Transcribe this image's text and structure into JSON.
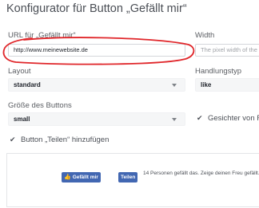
{
  "page": {
    "title": "Konfigurator für Button „Gefällt mir“"
  },
  "url_field": {
    "label": "URL für „Gefällt mir“",
    "value": "http://www.meinewebsite.de"
  },
  "width_field": {
    "label": "Width",
    "placeholder": "The pixel width of the"
  },
  "layout_select": {
    "label": "Layout",
    "selected": "standard"
  },
  "action_select": {
    "label": "Handlungstyp",
    "selected": "like"
  },
  "size_select": {
    "label": "Größe des Buttons",
    "selected": "small"
  },
  "faces_checkbox": {
    "label": "Gesichter von F",
    "checked": true
  },
  "share_checkbox": {
    "label": "Button „Teilen“ hinzufügen",
    "checked": true
  },
  "preview": {
    "like_label": "Gefällt mir",
    "share_label": "Teilen",
    "social_text": "14 Personen gefällt das. Zeige deinen Freu gefällt."
  },
  "icons": {
    "check": "✔",
    "thumb": "👍"
  },
  "colors": {
    "facebook_blue": "#4267b2",
    "annotation_red": "#e0262a"
  }
}
